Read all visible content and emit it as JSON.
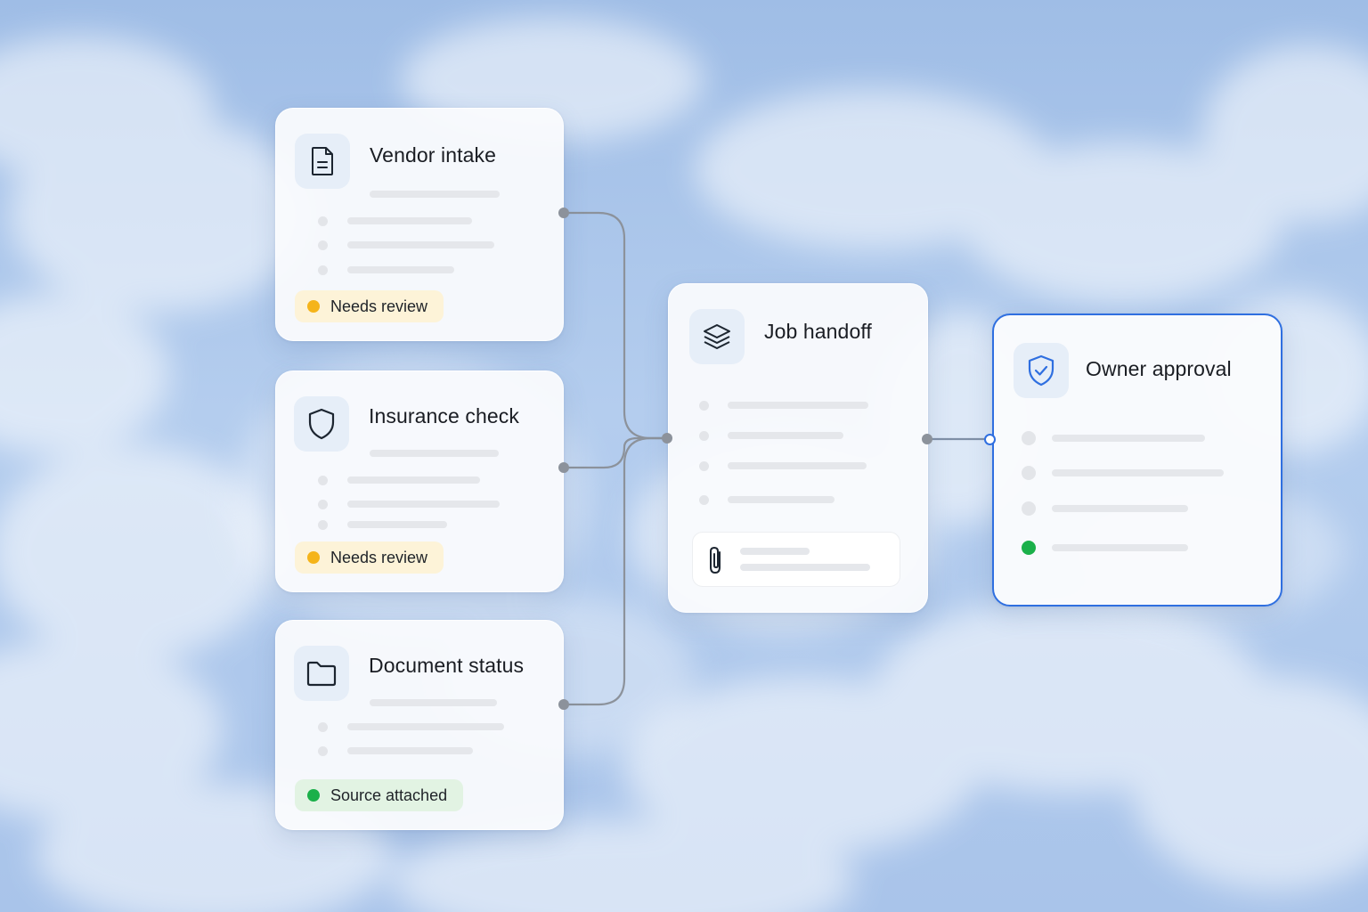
{
  "colors": {
    "accent": "#2f6fe0",
    "amber": "#f5b41a",
    "green": "#1bb04a",
    "connector": "#8c929b",
    "icon": "#1c2530"
  },
  "cards": {
    "vendor_intake": {
      "title": "Vendor intake",
      "icon": "document-icon",
      "badge": "Needs review"
    },
    "insurance_check": {
      "title": "Insurance check",
      "icon": "shield-icon",
      "badge": "Needs review"
    },
    "document_status": {
      "title": "Document status",
      "icon": "folder-icon",
      "badge": "Source attached"
    },
    "job_handoff": {
      "title": "Job handoff",
      "icon": "layers-icon",
      "attachment_icon": "paperclip-icon"
    },
    "owner_approval": {
      "title": "Owner approval",
      "icon": "shield-check-icon"
    }
  }
}
